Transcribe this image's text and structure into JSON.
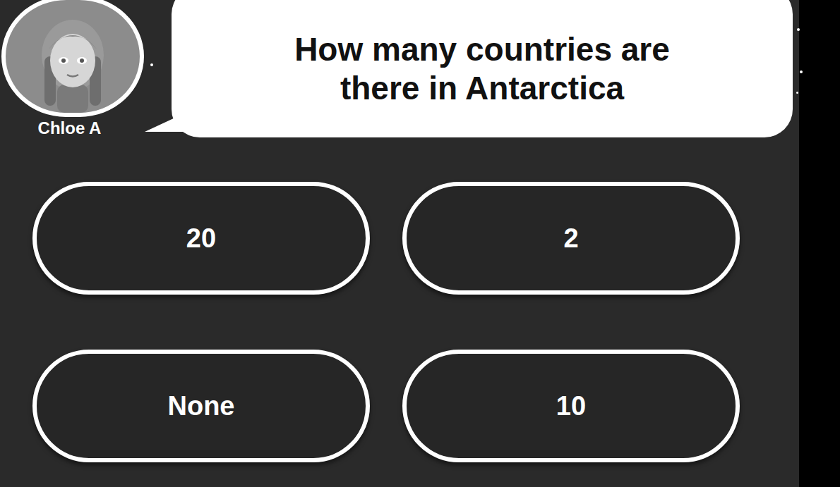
{
  "player": {
    "name": "Chloe A"
  },
  "question": "How many countries are there in Antarctica",
  "answers": [
    {
      "label": "20"
    },
    {
      "label": "2"
    },
    {
      "label": "None"
    },
    {
      "label": "10"
    }
  ]
}
